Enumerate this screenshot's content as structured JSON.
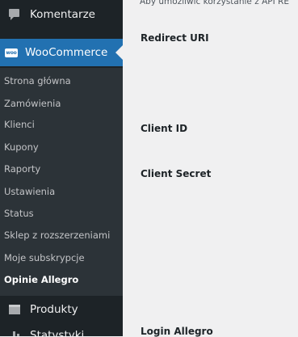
{
  "sidebar": {
    "comments": {
      "label": "Komentarze",
      "icon": "comments-icon"
    },
    "woocommerce": {
      "label": "WooCommerce",
      "icon": "woocommerce-icon",
      "badge": "woo"
    },
    "submenu": [
      {
        "label": "Strona główna"
      },
      {
        "label": "Zamówienia"
      },
      {
        "label": "Klienci"
      },
      {
        "label": "Kupony"
      },
      {
        "label": "Raporty"
      },
      {
        "label": "Ustawienia"
      },
      {
        "label": "Status"
      },
      {
        "label": "Sklep z rozszerzeniami"
      },
      {
        "label": "Moje subskrypcje"
      },
      {
        "label": "Opinie Allegro",
        "current": true
      }
    ],
    "products": {
      "label": "Produkty",
      "icon": "products-icon"
    },
    "stats": {
      "label": "Statystyki",
      "icon": "stats-icon"
    }
  },
  "main": {
    "description": "Aby umożliwić korzystanie z API RE",
    "fields": [
      {
        "label": "Redirect URI"
      },
      {
        "label": "Client ID"
      },
      {
        "label": "Client Secret"
      },
      {
        "label": "Login Allegro"
      }
    ]
  },
  "colors": {
    "sidebar_bg": "#1d2327",
    "submenu_bg": "#2c3338",
    "active_bg": "#2271b1",
    "content_bg": "#f0f0f1"
  }
}
